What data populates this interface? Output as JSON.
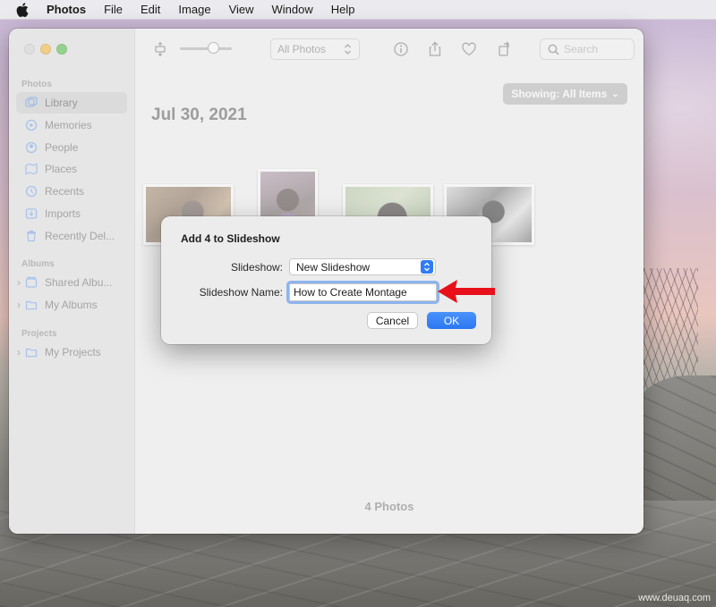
{
  "menubar": {
    "app": "Photos",
    "items": [
      "File",
      "Edit",
      "Image",
      "View",
      "Window",
      "Help"
    ]
  },
  "sidebar": {
    "photos_header": "Photos",
    "items": [
      {
        "label": "Library",
        "icon": "library-icon"
      },
      {
        "label": "Memories",
        "icon": "memories-icon"
      },
      {
        "label": "People",
        "icon": "people-icon"
      },
      {
        "label": "Places",
        "icon": "places-icon"
      },
      {
        "label": "Recents",
        "icon": "recents-icon"
      },
      {
        "label": "Imports",
        "icon": "imports-icon"
      },
      {
        "label": "Recently Del...",
        "icon": "trash-icon"
      }
    ],
    "albums_header": "Albums",
    "albums": [
      {
        "label": "Shared Albu...",
        "icon": "shared-album-icon"
      },
      {
        "label": "My Albums",
        "icon": "folder-icon"
      }
    ],
    "projects_header": "Projects",
    "projects": [
      {
        "label": "My Projects",
        "icon": "folder-icon"
      }
    ]
  },
  "toolbar": {
    "view_selector": "All Photos",
    "search_placeholder": "Search"
  },
  "main": {
    "showing_label": "Showing: All Items",
    "date_title": "Jul 30, 2021",
    "photo_count": "4 Photos"
  },
  "dialog": {
    "title": "Add 4 to Slideshow",
    "slideshow_label": "Slideshow:",
    "slideshow_value": "New Slideshow",
    "name_label": "Slideshow Name:",
    "name_value": "How to Create Montage",
    "cancel_label": "Cancel",
    "ok_label": "OK"
  },
  "watermark": "www.deuaq.com",
  "colors": {
    "accent": "#2b77f2",
    "arrow": "#e8101a",
    "traffic_min": "#f5bf4f",
    "traffic_max": "#61c454"
  }
}
